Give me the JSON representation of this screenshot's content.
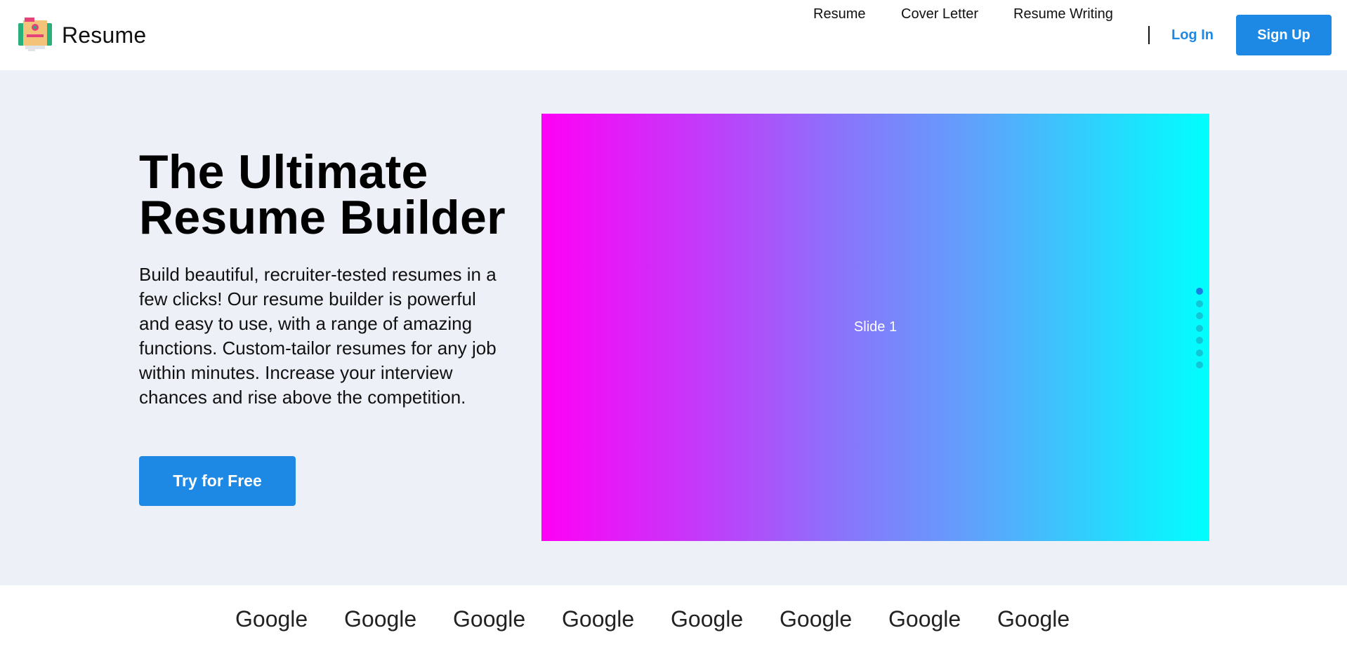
{
  "header": {
    "brand_name": "Resume",
    "nav": [
      {
        "label": "Resume"
      },
      {
        "label": "Cover Letter"
      },
      {
        "label": "Resume Writing"
      }
    ],
    "login_label": "Log In",
    "signup_label": "Sign Up"
  },
  "hero": {
    "title_line1": "The Ultimate",
    "title_line2": "Resume Builder",
    "description": "Build beautiful, recruiter-tested resumes in a few clicks! Our resume builder is powerful and easy to use, with a range of amazing functions. Custom-tailor resumes for any job within minutes. Increase your interview chances and rise above the competition.",
    "cta_label": "Try for Free"
  },
  "slider": {
    "current_slide_label": "Slide 1",
    "dot_count": 7,
    "active_dot": 0
  },
  "logos": [
    {
      "name": "Google"
    },
    {
      "name": "Google"
    },
    {
      "name": "Google"
    },
    {
      "name": "Google"
    },
    {
      "name": "Google"
    },
    {
      "name": "Google"
    },
    {
      "name": "Google"
    },
    {
      "name": "Google"
    }
  ],
  "colors": {
    "accent": "#1e88e5",
    "hero_bg": "#edf0f7",
    "slider_gradient_start": "#ff00f6",
    "slider_gradient_end": "#00fffe",
    "dot_active": "#1a7fe0",
    "dot_inactive": "#12c6d6"
  }
}
